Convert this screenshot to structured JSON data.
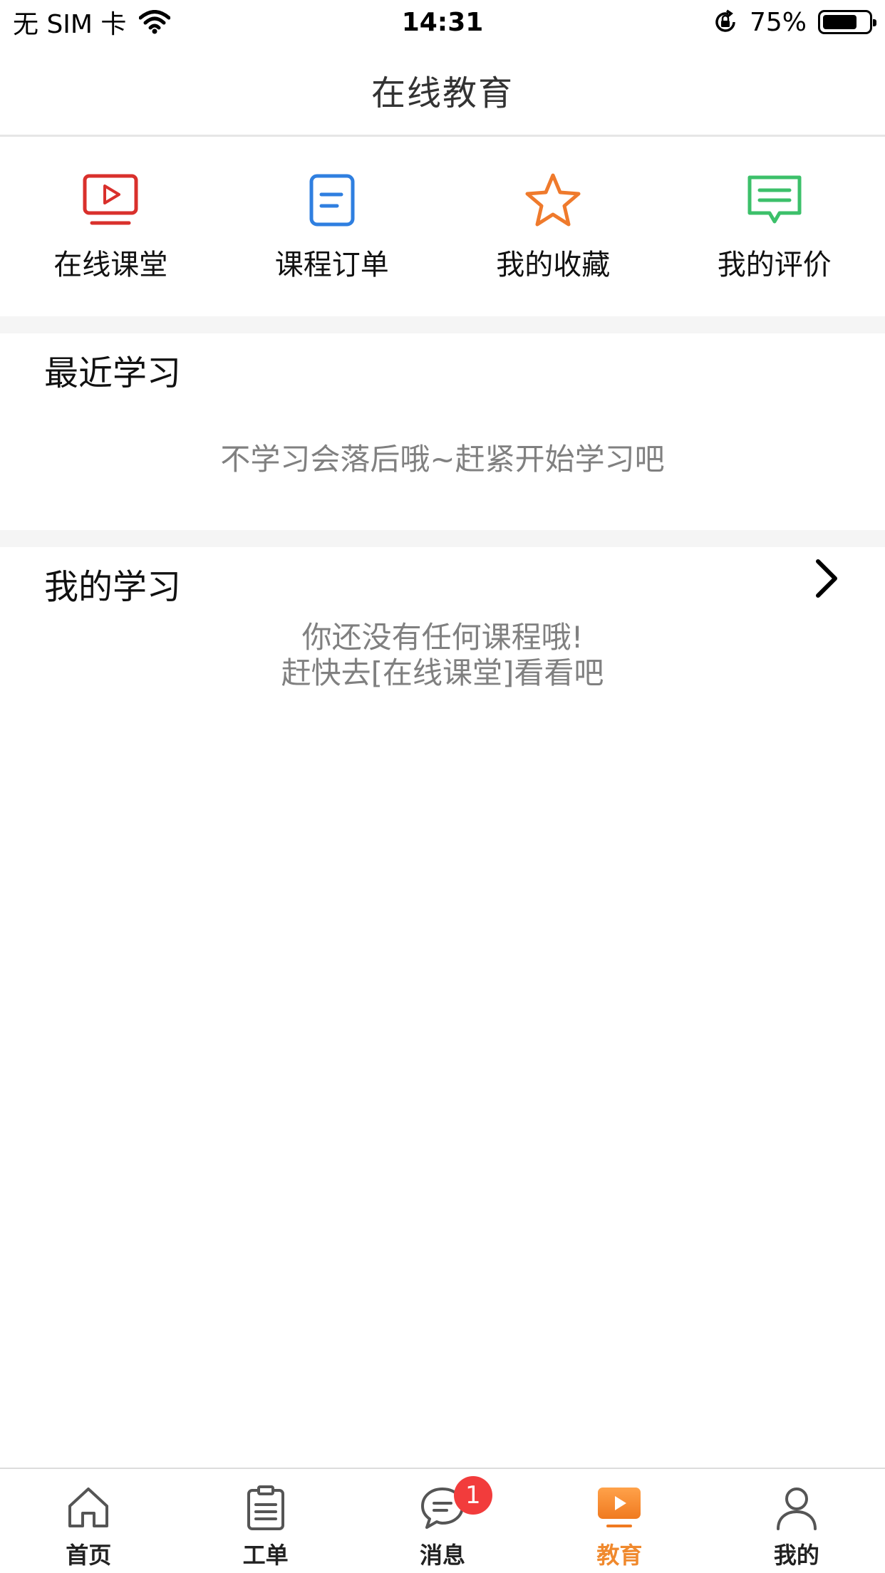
{
  "status_bar": {
    "carrier": "无 SIM 卡",
    "time": "14:31",
    "battery_percent": "75%",
    "battery_level": 0.75
  },
  "nav": {
    "title": "在线教育"
  },
  "quick_entries": [
    {
      "label": "在线课堂",
      "icon": "tv-play-icon",
      "color": "#d9302c"
    },
    {
      "label": "课程订单",
      "icon": "order-doc-icon",
      "color": "#2f7fe0"
    },
    {
      "label": "我的收藏",
      "icon": "star-icon",
      "color": "#ef7a2c"
    },
    {
      "label": "我的评价",
      "icon": "comment-icon",
      "color": "#3cc06a"
    }
  ],
  "recent": {
    "title": "最近学习",
    "empty_text": "不学习会落后哦~赶紧开始学习吧"
  },
  "my_study": {
    "title": "我的学习",
    "empty_line1": "你还没有任何课程哦!",
    "empty_line2": "赶快去[在线课堂]看看吧"
  },
  "tabs": [
    {
      "label": "首页",
      "icon": "home-icon",
      "active": false
    },
    {
      "label": "工单",
      "icon": "clipboard-icon",
      "active": false
    },
    {
      "label": "消息",
      "icon": "chat-icon",
      "active": false,
      "badge": "1"
    },
    {
      "label": "教育",
      "icon": "play-video-icon",
      "active": true
    },
    {
      "label": "我的",
      "icon": "user-icon",
      "active": false
    }
  ],
  "colors": {
    "accent": "#f0892d",
    "badge": "#f23c3c"
  }
}
